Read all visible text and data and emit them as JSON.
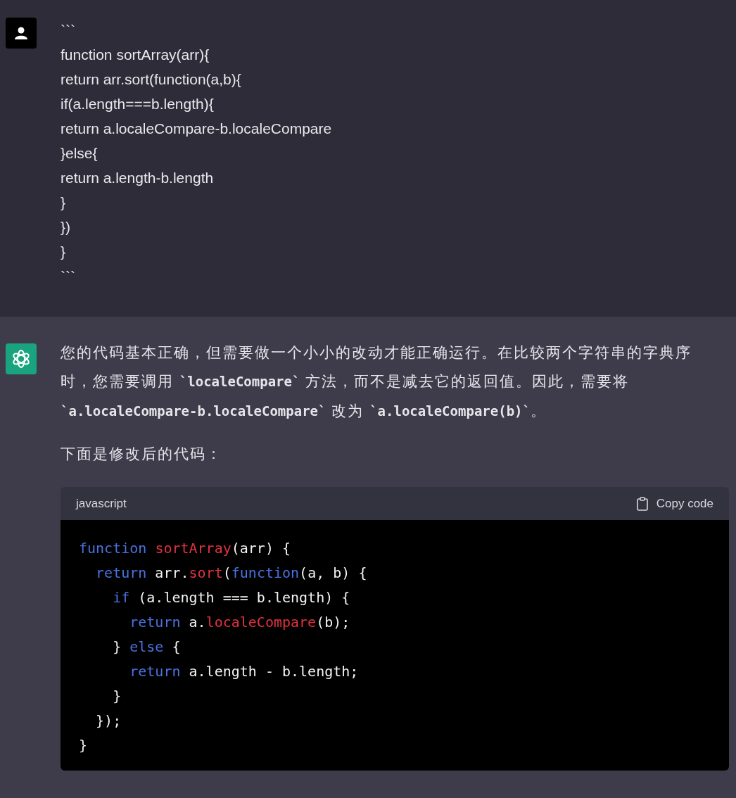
{
  "messages": [
    {
      "kind": "user",
      "lines": [
        "```",
        "function sortArray(arr){",
        "return arr.sort(function(a,b){",
        "if(a.length===b.length){",
        "return a.localeCompare-b.localeCompare",
        "}else{",
        "return a.length-b.length",
        "}",
        "})",
        "}",
        "```"
      ]
    },
    {
      "kind": "assistant",
      "paragraphs": [
        [
          {
            "kind": "text",
            "text": "您的代码基本正确，但需要做一个小小的改动才能正确运行。在比较两个字符串的字典序时，您需要调用 "
          },
          {
            "kind": "code",
            "text": "`localeCompare`"
          },
          {
            "kind": "text",
            "text": " 方法，而不是减去它的返回值。因此，需要将 "
          },
          {
            "kind": "code",
            "text": "`a.localeCompare-b.localeCompare`"
          },
          {
            "kind": "text",
            "text": " 改为 "
          },
          {
            "kind": "code",
            "text": "`a.localeCompare(b)`"
          },
          {
            "kind": "text",
            "text": "。"
          }
        ],
        [
          {
            "kind": "text",
            "text": "下面是修改后的代码："
          }
        ]
      ],
      "code_block": {
        "language": "javascript",
        "copy_label": "Copy code",
        "lines": [
          [
            {
              "kind": "keyword",
              "text": "function "
            },
            {
              "kind": "title",
              "text": "sortArray"
            },
            {
              "kind": "plain",
              "text": "(arr) {"
            }
          ],
          [
            {
              "kind": "keyword",
              "text": "  return"
            },
            {
              "kind": "plain",
              "text": " arr."
            },
            {
              "kind": "title",
              "text": "sort"
            },
            {
              "kind": "plain",
              "text": "("
            },
            {
              "kind": "keyword",
              "text": "function"
            },
            {
              "kind": "plain",
              "text": "(a, b) {"
            }
          ],
          [
            {
              "kind": "keyword",
              "text": "    if"
            },
            {
              "kind": "plain",
              "text": " (a.length === b.length) {"
            }
          ],
          [
            {
              "kind": "keyword",
              "text": "      return"
            },
            {
              "kind": "plain",
              "text": " a."
            },
            {
              "kind": "title",
              "text": "localeCompare"
            },
            {
              "kind": "plain",
              "text": "(b);"
            }
          ],
          [
            {
              "kind": "plain",
              "text": "    } "
            },
            {
              "kind": "keyword",
              "text": "else"
            },
            {
              "kind": "plain",
              "text": " {"
            }
          ],
          [
            {
              "kind": "keyword",
              "text": "      return"
            },
            {
              "kind": "plain",
              "text": " a.length - b.length;"
            }
          ],
          [
            {
              "kind": "plain",
              "text": "    }"
            }
          ],
          [
            {
              "kind": "plain",
              "text": "  });"
            }
          ],
          [
            {
              "kind": "plain",
              "text": "}"
            }
          ]
        ]
      }
    }
  ]
}
